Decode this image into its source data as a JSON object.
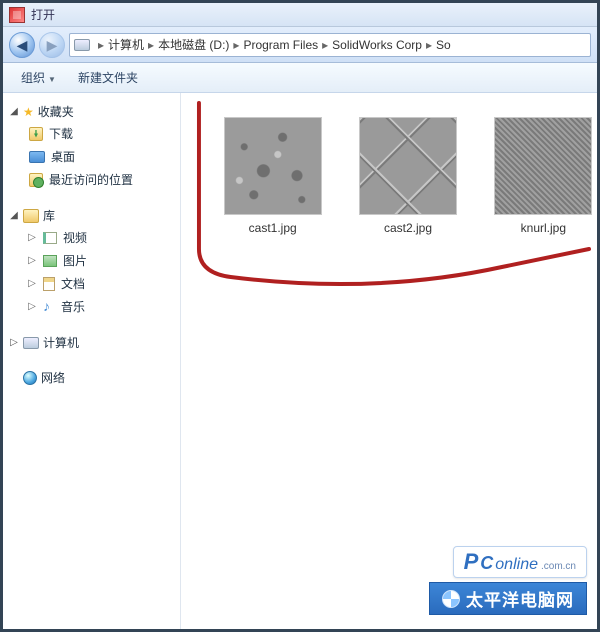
{
  "window": {
    "title": "打开"
  },
  "breadcrumb": {
    "items": [
      "计算机",
      "本地磁盘 (D:)",
      "Program Files",
      "SolidWorks Corp",
      "So"
    ]
  },
  "toolbar": {
    "organize": "组织",
    "new_folder": "新建文件夹"
  },
  "sidebar": {
    "favorites": {
      "label": "收藏夹",
      "items": [
        {
          "key": "downloads",
          "label": "下载"
        },
        {
          "key": "desktop",
          "label": "桌面"
        },
        {
          "key": "recent",
          "label": "最近访问的位置"
        }
      ]
    },
    "libraries": {
      "label": "库",
      "items": [
        {
          "key": "videos",
          "label": "视频"
        },
        {
          "key": "pictures",
          "label": "图片"
        },
        {
          "key": "documents",
          "label": "文档"
        },
        {
          "key": "music",
          "label": "音乐"
        }
      ]
    },
    "computer": {
      "label": "计算机"
    },
    "network": {
      "label": "网络"
    }
  },
  "files": [
    {
      "name": "cast1.jpg",
      "thumb": "cast1"
    },
    {
      "name": "cast2.jpg",
      "thumb": "cast2"
    },
    {
      "name": "knurl.jpg",
      "thumb": "knurl"
    }
  ],
  "watermark": {
    "brand_p": "P",
    "brand_c": "C",
    "brand_rest": "online",
    "tld": ".com.cn",
    "tagline": "太平洋电脑网"
  }
}
